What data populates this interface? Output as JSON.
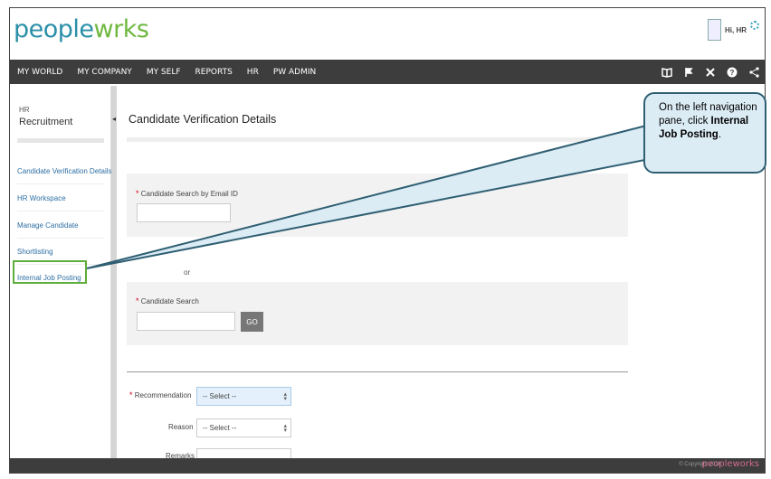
{
  "header": {
    "logo_part1": "pe",
    "logo_part2": "ople",
    "logo_part3": "w",
    "logo_part4": "rks",
    "user_greeting": "Hi, HR"
  },
  "nav": {
    "items": [
      "MY WORLD",
      "MY COMPANY",
      "MY SELF",
      "REPORTS",
      "HR",
      "PW ADMIN"
    ],
    "icons": [
      "book-icon",
      "flag-icon",
      "tools-icon",
      "help-icon",
      "share-icon"
    ]
  },
  "sidebar": {
    "module_small": "HR",
    "module": "Recruitment",
    "items": [
      "Candidate Verification Details",
      "HR Workspace",
      "Manage Candidate",
      "Shortlisting",
      "Internal Job Posting"
    ]
  },
  "main": {
    "title": "Candidate Verification Details",
    "email_label": "Candidate Search by Email ID",
    "email_value": "",
    "or_text": "or",
    "search_label": "Candidate Search",
    "search_value": "",
    "go_label": "GO",
    "recommendation_label": "Recommendation",
    "recommendation_value": "-- Select --",
    "reason_label": "Reason",
    "reason_value": "-- Select --",
    "remarks_label": "Remarks",
    "remarks_value": ""
  },
  "footer": {
    "copyright": "© Copyright 2016",
    "logo": "peopleworks"
  },
  "callout": {
    "line1": "On the left navigation pane, click ",
    "bold": "Internal Job Posting",
    "end": "."
  },
  "colors": {
    "brand_blue": "#2a8fa8",
    "brand_green": "#6fb83f",
    "nav_bg": "#3d3d3d",
    "highlight_green": "#5fae3a",
    "callout_bg": "#dcecf5",
    "required_red": "#d0021b"
  }
}
